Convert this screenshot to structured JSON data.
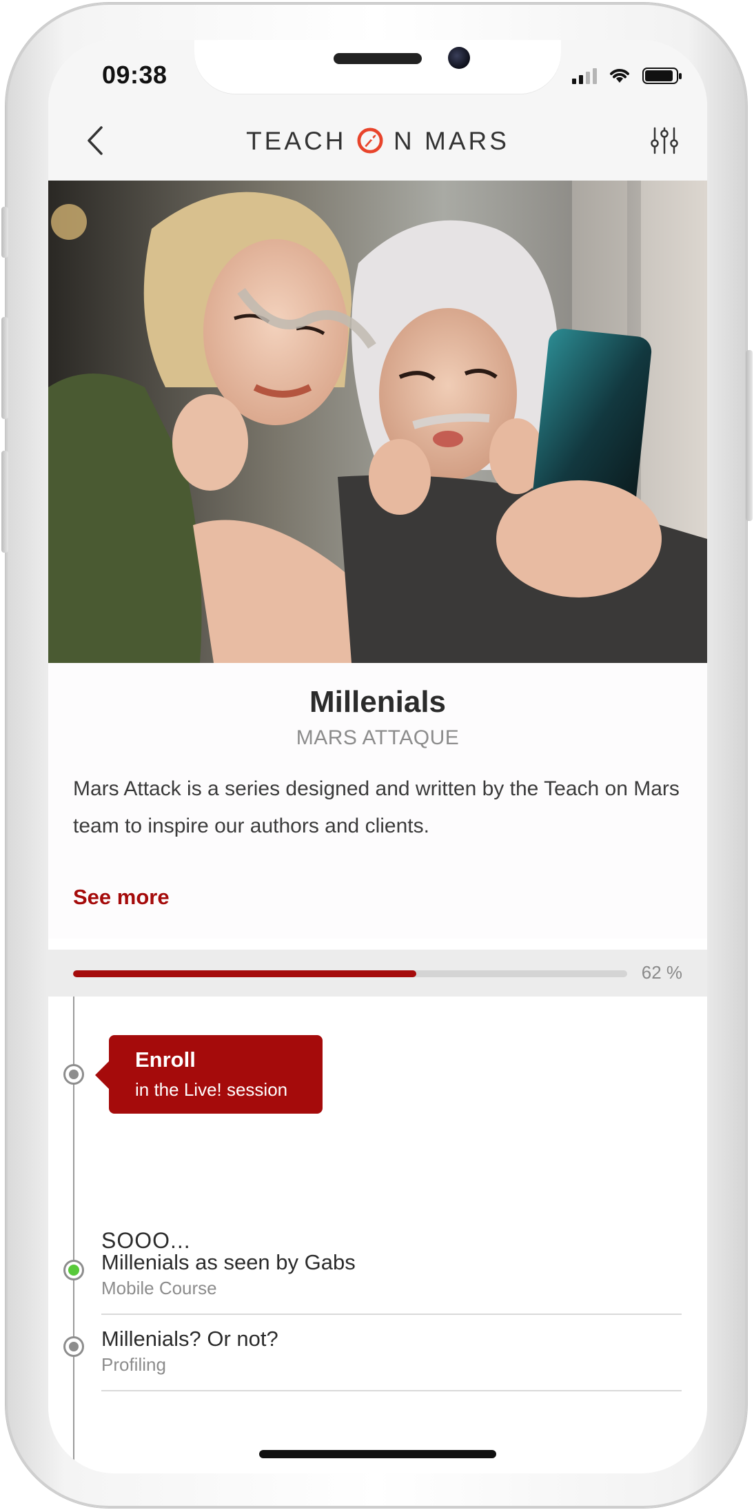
{
  "status_bar": {
    "time": "09:38"
  },
  "header": {
    "logo_left": "TEACH",
    "logo_right": "N MARS"
  },
  "course": {
    "title": "Millenials",
    "series": "MARS ATTAQUE",
    "description": "Mars Attack is a series designed and written by the Teach on Mars team to inspire our authors and clients.",
    "see_more_label": "See more"
  },
  "progress": {
    "percent": 62,
    "label": "62 %"
  },
  "enroll": {
    "title": "Enroll",
    "subtitle": "in the Live! session"
  },
  "section": {
    "heading": "SOOO..."
  },
  "items": [
    {
      "title": "Millenials as seen by Gabs",
      "type": "Mobile Course",
      "status": "completed"
    },
    {
      "title": "Millenials? Or not?",
      "type": "Profiling",
      "status": "pending"
    }
  ],
  "colors": {
    "accent": "#a50b0b",
    "completed": "#58c93a",
    "pending": "#8d8d8d"
  }
}
